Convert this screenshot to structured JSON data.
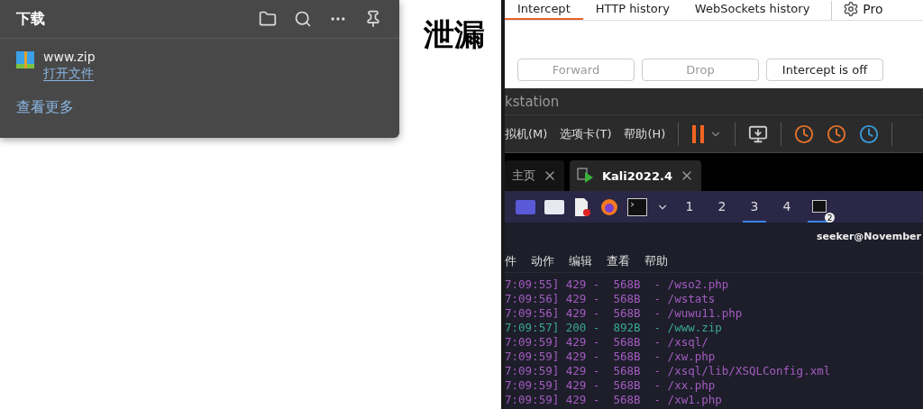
{
  "download_panel": {
    "title": "下载",
    "items": [
      {
        "file": "www.zip",
        "action": "打开文件"
      }
    ],
    "more": "查看更多"
  },
  "page": {
    "heading": "泄漏"
  },
  "burp": {
    "tabs": [
      {
        "label": "Intercept",
        "selected": true
      },
      {
        "label": "HTTP history",
        "selected": false
      },
      {
        "label": "WebSockets history",
        "selected": false
      }
    ],
    "settings": "Pro",
    "buttons": [
      {
        "label": "Forward",
        "disabled": true
      },
      {
        "label": "Drop",
        "disabled": true
      },
      {
        "label": "Intercept is off",
        "disabled": false
      }
    ]
  },
  "vmware": {
    "title": "kstation",
    "menu": [
      "拟机(M)",
      "选项卡(T)",
      "帮助(H)"
    ],
    "tabs": [
      {
        "label": "主页",
        "selected": false
      },
      {
        "label": "Kali2022.4",
        "selected": true
      }
    ]
  },
  "kali": {
    "workspaces": [
      {
        "label": "1",
        "selected": false
      },
      {
        "label": "2",
        "selected": false
      },
      {
        "label": "3",
        "selected": true
      },
      {
        "label": "4",
        "selected": false
      }
    ],
    "terminal_badge": "2",
    "terminal_title": "seeker@November",
    "menu": [
      "件",
      "动作",
      "编辑",
      "查看",
      "帮助"
    ],
    "log": [
      {
        "text": "7:09:55] 429 -  568B  - /wso2.php",
        "kind": "blocked"
      },
      {
        "text": "7:09:56] 429 -  568B  - /wstats",
        "kind": "blocked"
      },
      {
        "text": "7:09:56] 429 -  568B  - /wuwu11.php",
        "kind": "blocked"
      },
      {
        "text": "7:09:57] 200 -  892B  - /www.zip",
        "kind": "found"
      },
      {
        "text": "7:09:59] 429 -  568B  - /xsql/",
        "kind": "blocked"
      },
      {
        "text": "7:09:59] 429 -  568B  - /xw.php",
        "kind": "blocked"
      },
      {
        "text": "7:09:59] 429 -  568B  - /xsql/lib/XSQLConfig.xml",
        "kind": "blocked"
      },
      {
        "text": "7:09:59] 429 -  568B  - /xx.php",
        "kind": "blocked"
      },
      {
        "text": "7:09:59] 429 -  568B  - /xw1.php",
        "kind": "blocked"
      }
    ]
  }
}
